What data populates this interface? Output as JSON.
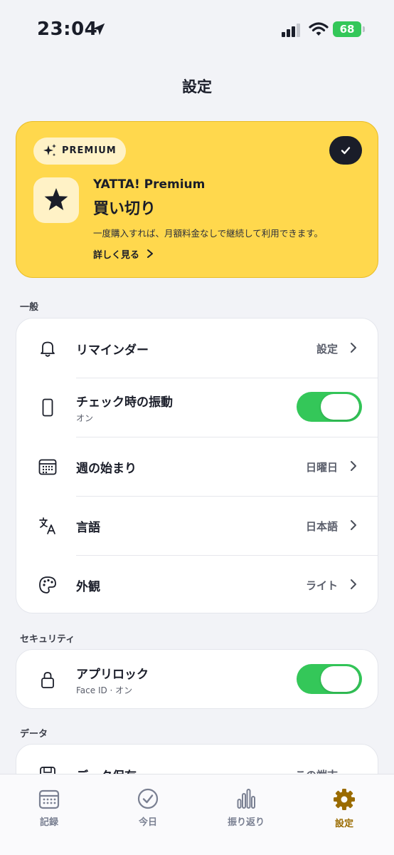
{
  "status_bar": {
    "time": "23:04",
    "battery": "68"
  },
  "header": {
    "title": "設定"
  },
  "premium": {
    "badge": "PREMIUM",
    "name": "YATTA! Premium",
    "plan": "買い切り",
    "description": "一度購入すれば、月額料金なしで継続して利用できます。",
    "more_link": "詳しく見る"
  },
  "sections": {
    "general": {
      "label": "一般",
      "rows": [
        {
          "title": "リマインダー",
          "value": "設定"
        },
        {
          "title": "チェック時の振動",
          "subtitle": "オン",
          "toggle": true
        },
        {
          "title": "週の始まり",
          "value": "日曜日"
        },
        {
          "title": "言語",
          "value": "日本語"
        },
        {
          "title": "外観",
          "value": "ライト"
        }
      ]
    },
    "security": {
      "label": "セキュリティ",
      "rows": [
        {
          "title": "アプリロック",
          "subtitle": "Face ID · オン",
          "toggle": true
        }
      ]
    },
    "data": {
      "label": "データ",
      "rows": [
        {
          "title": "データ保存",
          "value": "この端末"
        }
      ]
    }
  },
  "tab_bar": {
    "tabs": [
      {
        "label": "記録",
        "icon": "calendar-icon"
      },
      {
        "label": "今日",
        "icon": "check-circle-icon"
      },
      {
        "label": "振り返り",
        "icon": "bar-chart-icon"
      },
      {
        "label": "設定",
        "icon": "gear-icon",
        "active": true
      }
    ]
  },
  "colors": {
    "accent": "#FFD84D",
    "toggle_on": "#34C759",
    "active_tab": "#9A6B00"
  }
}
